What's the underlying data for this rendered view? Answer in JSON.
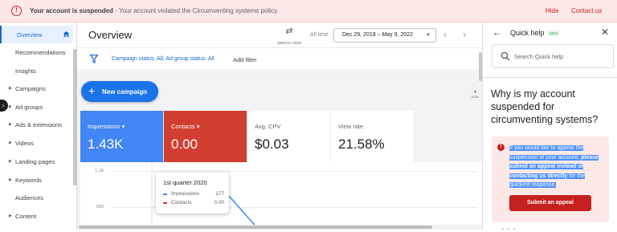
{
  "banner": {
    "title_bold": "Your account is suspended",
    "message": " - Your account violated the Circumventing systems policy.",
    "hide_label": "Hide",
    "contact_label": "Contact us"
  },
  "sidebar": {
    "items": [
      {
        "label": "Overview",
        "active": true,
        "expandable": false
      },
      {
        "label": "Recommendations",
        "active": false,
        "expandable": false
      },
      {
        "label": "Insights",
        "active": false,
        "expandable": false
      },
      {
        "label": "Campaigns",
        "active": false,
        "expandable": true
      },
      {
        "label": "Ad groups",
        "active": false,
        "expandable": true
      },
      {
        "label": "Ads & extensions",
        "active": false,
        "expandable": true
      },
      {
        "label": "Videos",
        "active": false,
        "expandable": true
      },
      {
        "label": "Landing pages",
        "active": false,
        "expandable": true
      },
      {
        "label": "Keywords",
        "active": false,
        "expandable": true
      },
      {
        "label": "Audiences",
        "active": false,
        "expandable": false
      },
      {
        "label": "Content",
        "active": false,
        "expandable": true
      }
    ]
  },
  "header": {
    "title": "Overview",
    "switch_view_label": "SWITCH VIEW",
    "all_time_label": "All time",
    "date_range": "Dec 29, 2019 – May 9, 2022"
  },
  "filter": {
    "status_text": "Campaign status: All; Ad group status: All",
    "add_filter_label": "Add filter"
  },
  "toolbar": {
    "new_campaign_label": "New campaign",
    "partial_label": "DON"
  },
  "metrics": [
    {
      "name": "Impressions",
      "value": "1.43K",
      "dropdown": true
    },
    {
      "name": "Contacts",
      "value": "0.00",
      "dropdown": true
    },
    {
      "name": "Avg. CPV",
      "value": "$0.03",
      "dropdown": false
    },
    {
      "name": "View rate",
      "value": "21.58%",
      "dropdown": false
    }
  ],
  "chart_data": {
    "type": "line",
    "series": [
      {
        "name": "Impressions",
        "color": "#4285f4"
      },
      {
        "name": "Contacts",
        "color": "#d23f31"
      }
    ],
    "y_ticks": [
      "1.1K",
      "550"
    ],
    "tooltip": {
      "title": "1st quarter 2020",
      "rows": [
        {
          "name": "Impressions",
          "value": "177",
          "color": "#4285f4"
        },
        {
          "name": "Contacts",
          "value": "0.00",
          "color": "#d23f31"
        }
      ]
    }
  },
  "quick_help": {
    "title": "Quick help",
    "beta_label": "BETA",
    "search_placeholder": "Search Quick help",
    "question": "Why is my account suspended for circumventing systems?",
    "notice_text_1": "If you would like to appeal the suspension of your account, ",
    "notice_text_bold": "please submit an appeal instead of contacting us directly",
    "notice_text_2": " for the quickest response.",
    "appeal_button_label": "Submit an appeal"
  }
}
